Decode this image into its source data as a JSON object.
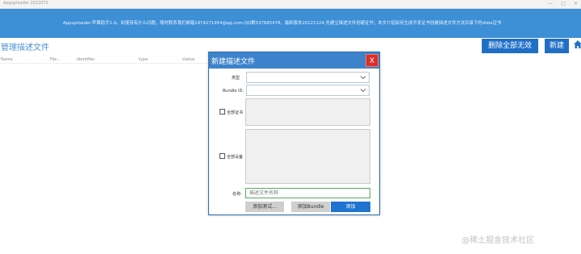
{
  "window": {
    "title": "Appuploader 2022072"
  },
  "banner": {
    "notice": "Appuploader-苹果助手1.0。如使用有什么问题，随时联系我们邮箱1974271954@qq.com,QQ群337685478，最新版本20221124,先建立描述文件创建证书；本文介绍如何生成开发证书创建描述文件方法目录下的dsbe证书"
  },
  "header": {
    "title": "管理描述文件",
    "clear_all_label": "删除全部无效",
    "new_label": "新建"
  },
  "table": {
    "columns": [
      "Name",
      "File...",
      "identifier",
      "type",
      "status"
    ]
  },
  "dialog": {
    "title": "新建描述文件",
    "close_label": "X",
    "type_label": "类型",
    "bundle_label": "Bundle ID:",
    "all_cert_label": "全部证书",
    "all_device_label": "全部设备",
    "name_label": "名称:",
    "name_placeholder": "描述文件名称",
    "add_test_label": "添加测试...",
    "add_bundle_label": "添加Bundle",
    "add_label": "添加"
  },
  "watermark": "@稀土掘金技术社区",
  "colors": {
    "banner": "#3d8fd6",
    "primary_button": "#1f6fc6",
    "close": "#d9302a",
    "name_border": "#56a85a"
  }
}
